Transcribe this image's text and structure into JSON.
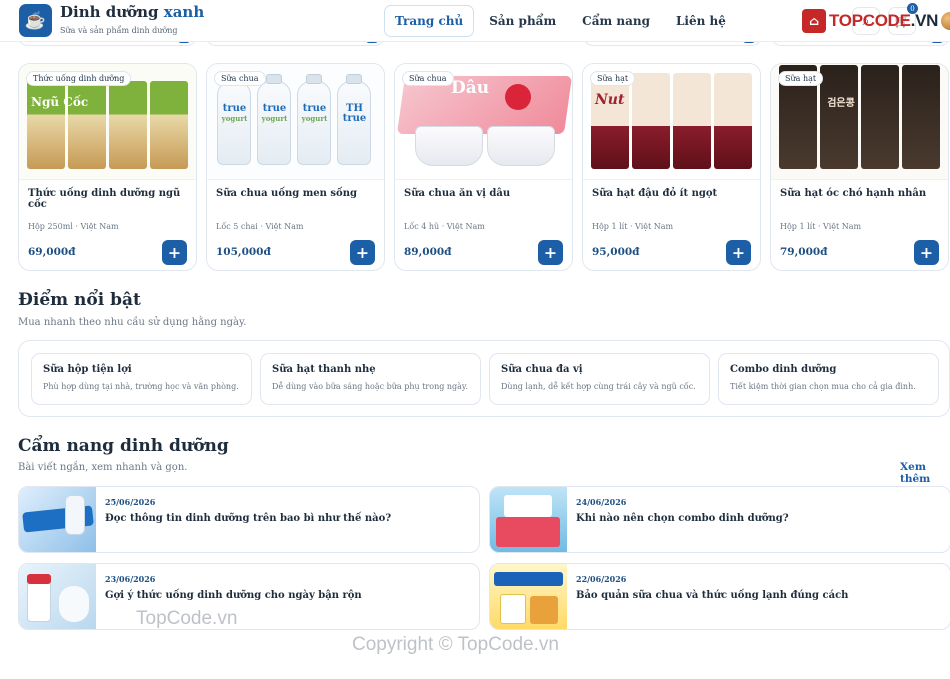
{
  "header": {
    "brand_main": "Dinh dưỡng ",
    "brand_accent": "xanh",
    "tagline": "Sữa và sản phẩm dinh dưỡng",
    "nav": [
      {
        "label": "Trang chủ",
        "active": true
      },
      {
        "label": "Sản phẩm",
        "active": false
      },
      {
        "label": "Cẩm nang",
        "active": false
      },
      {
        "label": "Liên hệ",
        "active": false
      }
    ],
    "cart_count": "0"
  },
  "watermark": {
    "logo_text": "TOPCODE.VN",
    "center_text": "TopCode.vn",
    "copyright": "Copyright © TopCode.vn"
  },
  "products": [
    {
      "tag": "Thức uống dinh dưỡng",
      "name": "Thức uống dinh dưỡng ngũ cốc",
      "meta": "Hộp 250ml · Việt Nam",
      "price": "69,000đ",
      "art_label": "Ngũ Cốc"
    },
    {
      "tag": "Sữa chua",
      "name": "Sữa chua uống men sống",
      "meta": "Lốc 5 chai · Việt Nam",
      "price": "105,000đ",
      "art_label": "TH true"
    },
    {
      "tag": "Sữa chua",
      "name": "Sữa chua ăn vị dâu",
      "meta": "Lốc 4 hũ · Việt Nam",
      "price": "89,000đ",
      "art_label": "Dâu"
    },
    {
      "tag": "Sữa hạt",
      "name": "Sữa hạt đậu đỏ ít ngọt",
      "meta": "Hộp 1 lít · Việt Nam",
      "price": "95,000đ",
      "art_label": "Nut"
    },
    {
      "tag": "Sữa hạt",
      "name": "Sữa hạt óc chó hạnh nhân",
      "meta": "Hộp 1 lít · Việt Nam",
      "price": "79,000đ",
      "art_label": "검은콩"
    }
  ],
  "highlights": {
    "title": "Điểm nổi bật",
    "subtitle": "Mua nhanh theo nhu cầu sử dụng hằng ngày.",
    "items": [
      {
        "title": "Sữa hộp tiện lợi",
        "desc": "Phù hợp dùng tại nhà, trường học và văn phòng."
      },
      {
        "title": "Sữa hạt thanh nhẹ",
        "desc": "Dễ dùng vào bữa sáng hoặc bữa phụ trong ngày."
      },
      {
        "title": "Sữa chua đa vị",
        "desc": "Dùng lạnh, dễ kết hợp cùng trái cây và ngũ cốc."
      },
      {
        "title": "Combo dinh dưỡng",
        "desc": "Tiết kiệm thời gian chọn mua cho cả gia đình."
      }
    ]
  },
  "guide": {
    "title": "Cẩm nang dinh dưỡng",
    "subtitle": "Bài viết ngắn, xem nhanh và gọn.",
    "see_all": "Xem thêm",
    "articles": [
      {
        "date": "25/06/2026",
        "title": "Đọc thông tin dinh dưỡng trên bao bì như thế nào?"
      },
      {
        "date": "24/06/2026",
        "title": "Khi nào nên chọn combo dinh dưỡng?"
      },
      {
        "date": "23/06/2026",
        "title": "Gợi ý thức uống dinh dưỡng cho ngày bận rộn"
      },
      {
        "date": "22/06/2026",
        "title": "Bảo quản sữa chua và thức uống lạnh đúng cách"
      }
    ]
  },
  "colors": {
    "primary": "#1d5fa6",
    "text": "#1e2d3d",
    "muted": "#6b7785"
  },
  "icons": {
    "logo": "coffee-cup-icon",
    "add": "plus-icon"
  }
}
